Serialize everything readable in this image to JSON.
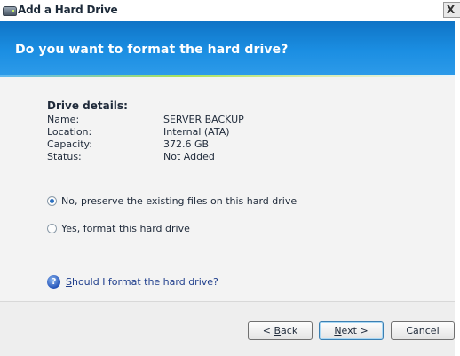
{
  "window": {
    "title": "Add a Hard Drive",
    "close_label": "X"
  },
  "header": {
    "title": "Do you want to format the hard drive?"
  },
  "details": {
    "heading": "Drive details:",
    "rows": [
      {
        "label": "Name:",
        "value": "SERVER BACKUP"
      },
      {
        "label": "Location:",
        "value": "Internal (ATA)"
      },
      {
        "label": "Capacity:",
        "value": "372.6 GB"
      },
      {
        "label": "Status:",
        "value": "Not Added"
      }
    ]
  },
  "options": [
    {
      "label": "No, preserve the existing files on this hard drive",
      "selected": true
    },
    {
      "label": "Yes, format this hard drive",
      "selected": false
    }
  ],
  "help": {
    "icon": "help-icon",
    "link_first": "S",
    "link_rest": "hould I format the hard drive?"
  },
  "buttons": {
    "back_prefix": "< ",
    "back_mnemonic": "B",
    "back_rest": "ack",
    "next_mnemonic": "N",
    "next_rest": "ext >",
    "cancel": "Cancel"
  }
}
